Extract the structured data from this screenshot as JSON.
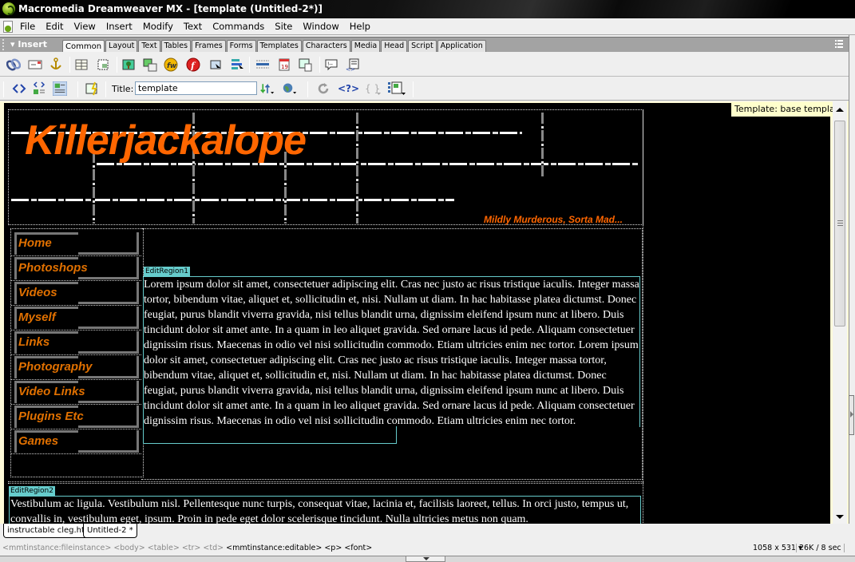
{
  "window": {
    "title": "Macromedia Dreamweaver MX - [template (Untitled-2*)]"
  },
  "menu": [
    "File",
    "Edit",
    "View",
    "Insert",
    "Modify",
    "Text",
    "Commands",
    "Site",
    "Window",
    "Help"
  ],
  "insert_bar": {
    "label": "Insert",
    "tabs": [
      "Common",
      "Layout",
      "Text",
      "Tables",
      "Frames",
      "Forms",
      "Templates",
      "Characters",
      "Media",
      "Head",
      "Script",
      "Application"
    ],
    "active_tab": "Common",
    "icons": [
      "hyperlink-icon",
      "email-link-icon",
      "named-anchor-icon",
      "table-icon",
      "layer-icon",
      "image-icon",
      "fireworks-html-icon",
      "flash-text-icon",
      "flash-icon",
      "image-placeholder-icon",
      "navigation-bar-icon",
      "horizontal-rule-icon",
      "date-icon",
      "tabular-data-icon",
      "comment-icon",
      "tag-chooser-icon"
    ]
  },
  "document_toolbar": {
    "view_icons": [
      "code-view-icon",
      "split-view-icon",
      "design-view-icon",
      "live-data-icon"
    ],
    "title_label": "Title:",
    "title_value": "template",
    "right_icons": [
      "file-management-icon",
      "preview-browser-icon",
      "refresh-icon",
      "reference-icon",
      "code-navigation-icon",
      "view-options-icon"
    ]
  },
  "template_label": "Template: base template",
  "page": {
    "logo": "Killerjackalope",
    "tagline": "Mildly Murderous, Sorta Mad...",
    "nav": [
      "Home",
      "Photoshops",
      "Videos",
      "Myself",
      "Links",
      "Photography",
      "Video Links",
      "Plugins Etc",
      "Games"
    ],
    "region1": {
      "name": "EditRegion1",
      "text": "Lorem ipsum dolor sit amet, consectetuer adipiscing elit. Cras nec justo ac risus tristique iaculis. Integer massa tortor, bibendum vitae, aliquet et, sollicitudin et, nisi. Nullam ut diam. In hac habitasse platea dictumst. Donec feugiat, purus blandit viverra gravida, nisi tellus blandit urna, dignissim eleifend ipsum nunc at libero. Duis tincidunt dolor sit amet ante. In a quam in leo aliquet gravida. Sed ornare lacus id pede. Aliquam consectetuer dignissim risus. Maecenas in odio vel nisi sollicitudin commodo. Etiam ultricies enim nec tortor. Lorem ipsum dolor sit amet, consectetuer adipiscing elit. Cras nec justo ac risus tristique iaculis. Integer massa tortor, bibendum vitae, aliquet et, sollicitudin et, nisi. Nullam ut diam. In hac habitasse platea dictumst. Donec feugiat, purus blandit viverra gravida, nisi tellus blandit urna, dignissim eleifend ipsum nunc at libero. Duis tincidunt dolor sit amet ante. In a quam in leo aliquet gravida. Sed ornare lacus id pede. Aliquam consectetuer dignissim risus. Maecenas in odio vel nisi sollicitudin commodo. Etiam ultricies enim nec tortor."
    },
    "region2": {
      "name": "EditRegion2",
      "text": "Vestibulum ac ligula. Vestibulum nisl. Pellentesque nunc turpis, consequat vitae, lacinia et, facilisis laoreet, tellus. In orci justo, tempus ut, convallis in, vestibulum eget, ipsum. Proin in pede eget dolor scelerisque tincidunt. Nulla ultricies metus non quam."
    }
  },
  "doc_tabs": [
    "instructable cleg.htm *",
    "Untitled-2 *"
  ],
  "status": {
    "tag_path": [
      "<mmtinstance:fileinstance>",
      "<body>",
      "<table>",
      "<tr>",
      "<td>"
    ],
    "current_tags": [
      "<mmtinstance:editable>",
      "<p>",
      "<font>"
    ],
    "window_size": "1058 x 531",
    "download": "26K / 8 sec"
  },
  "colors": {
    "brand_orange": "#ff6600",
    "nav_orange": "#e07000",
    "region_cyan": "#66cccc",
    "tooltip_yellow": "#ffffcc"
  }
}
